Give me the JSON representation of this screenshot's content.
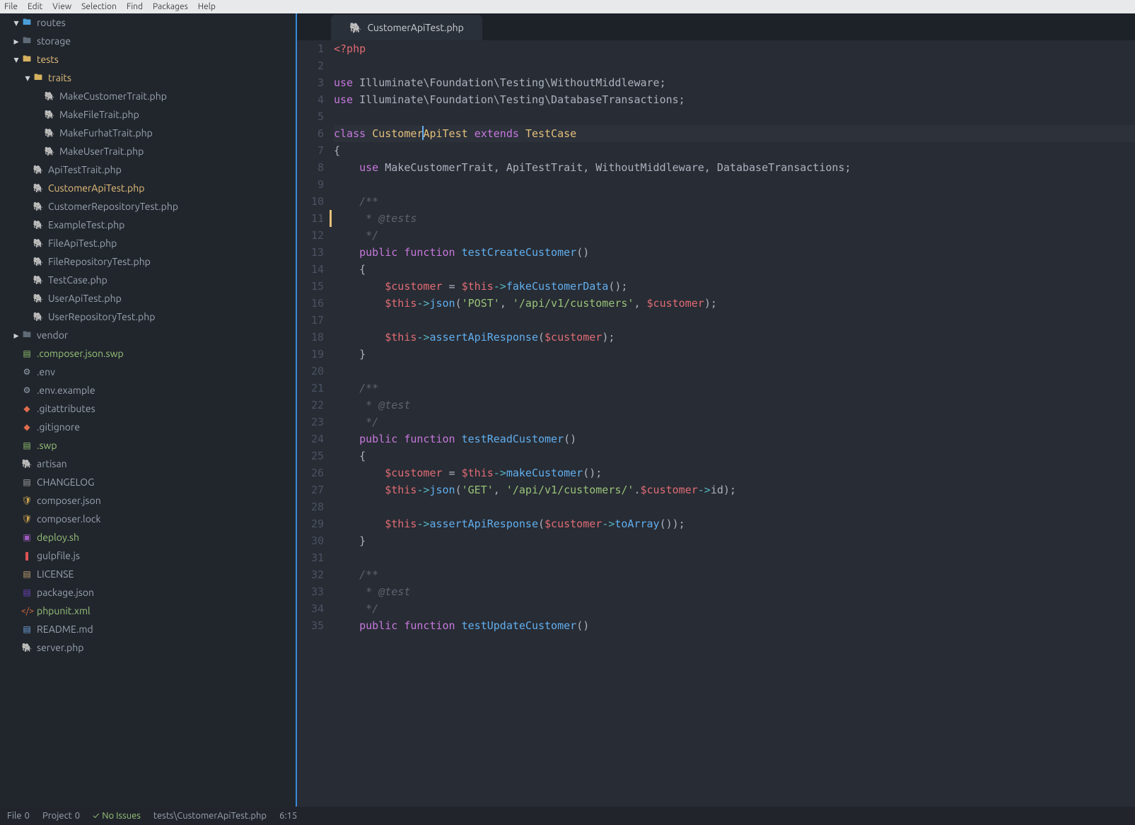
{
  "menu": [
    "File",
    "Edit",
    "View",
    "Selection",
    "Find",
    "Packages",
    "Help"
  ],
  "tree": [
    {
      "depth": 1,
      "caret": "▾",
      "icon": "folder open",
      "label": "routes",
      "tone": ""
    },
    {
      "depth": 1,
      "caret": "▸",
      "icon": "folder",
      "label": "storage",
      "tone": ""
    },
    {
      "depth": 1,
      "caret": "▾",
      "icon": "folder yellow",
      "label": "tests",
      "tone": "yellow"
    },
    {
      "depth": 2,
      "caret": "▾",
      "icon": "folder yellow",
      "label": "traits",
      "tone": "yellow"
    },
    {
      "depth": 3,
      "caret": " ",
      "icon": "php",
      "label": "MakeCustomerTrait.php",
      "tone": ""
    },
    {
      "depth": 3,
      "caret": " ",
      "icon": "php",
      "label": "MakeFileTrait.php",
      "tone": ""
    },
    {
      "depth": 3,
      "caret": " ",
      "icon": "php",
      "label": "MakeFurhatTrait.php",
      "tone": ""
    },
    {
      "depth": 3,
      "caret": " ",
      "icon": "php",
      "label": "MakeUserTrait.php",
      "tone": ""
    },
    {
      "depth": 2,
      "caret": " ",
      "icon": "php",
      "label": "ApiTestTrait.php",
      "tone": ""
    },
    {
      "depth": 2,
      "caret": " ",
      "icon": "php",
      "label": "CustomerApiTest.php",
      "tone": "selected"
    },
    {
      "depth": 2,
      "caret": " ",
      "icon": "php",
      "label": "CustomerRepositoryTest.php",
      "tone": ""
    },
    {
      "depth": 2,
      "caret": " ",
      "icon": "php",
      "label": "ExampleTest.php",
      "tone": ""
    },
    {
      "depth": 2,
      "caret": " ",
      "icon": "php",
      "label": "FileApiTest.php",
      "tone": ""
    },
    {
      "depth": 2,
      "caret": " ",
      "icon": "php",
      "label": "FileRepositoryTest.php",
      "tone": ""
    },
    {
      "depth": 2,
      "caret": " ",
      "icon": "php",
      "label": "TestCase.php",
      "tone": ""
    },
    {
      "depth": 2,
      "caret": " ",
      "icon": "php",
      "label": "UserApiTest.php",
      "tone": ""
    },
    {
      "depth": 2,
      "caret": " ",
      "icon": "php",
      "label": "UserRepositoryTest.php",
      "tone": ""
    },
    {
      "depth": 1,
      "caret": "▸",
      "icon": "folder",
      "label": "vendor",
      "tone": ""
    },
    {
      "depth": 1,
      "caret": " ",
      "icon": "db",
      "label": ".composer.json.swp",
      "tone": "green"
    },
    {
      "depth": 1,
      "caret": " ",
      "icon": "gear",
      "label": ".env",
      "tone": ""
    },
    {
      "depth": 1,
      "caret": " ",
      "icon": "gear",
      "label": ".env.example",
      "tone": ""
    },
    {
      "depth": 1,
      "caret": " ",
      "icon": "git",
      "label": ".gitattributes",
      "tone": ""
    },
    {
      "depth": 1,
      "caret": " ",
      "icon": "git",
      "label": ".gitignore",
      "tone": ""
    },
    {
      "depth": 1,
      "caret": " ",
      "icon": "db",
      "label": ".swp",
      "tone": "green"
    },
    {
      "depth": 1,
      "caret": " ",
      "icon": "php",
      "label": "artisan",
      "tone": ""
    },
    {
      "depth": 1,
      "caret": " ",
      "icon": "txt",
      "label": "CHANGELOG",
      "tone": ""
    },
    {
      "depth": 1,
      "caret": " ",
      "icon": "lock",
      "label": "composer.json",
      "tone": ""
    },
    {
      "depth": 1,
      "caret": " ",
      "icon": "lock",
      "label": "composer.lock",
      "tone": ""
    },
    {
      "depth": 1,
      "caret": " ",
      "icon": "sh",
      "label": "deploy.sh",
      "tone": "green"
    },
    {
      "depth": 1,
      "caret": " ",
      "icon": "js",
      "label": "gulpfile.js",
      "tone": ""
    },
    {
      "depth": 1,
      "caret": " ",
      "icon": "lic",
      "label": "LICENSE",
      "tone": ""
    },
    {
      "depth": 1,
      "caret": " ",
      "icon": "json",
      "label": "package.json",
      "tone": ""
    },
    {
      "depth": 1,
      "caret": " ",
      "icon": "xml",
      "label": "phpunit.xml",
      "tone": "green"
    },
    {
      "depth": 1,
      "caret": " ",
      "icon": "md",
      "label": "README.md",
      "tone": ""
    },
    {
      "depth": 1,
      "caret": " ",
      "icon": "php",
      "label": "server.php",
      "tone": ""
    }
  ],
  "tab": {
    "label": "CustomerApiTest.php"
  },
  "code": {
    "current_line": 6,
    "fold_markers": [
      11
    ],
    "lines": [
      [
        {
          "c": "php",
          "t": "<?php"
        }
      ],
      [],
      [
        {
          "c": "kw",
          "t": "use"
        },
        {
          "t": " "
        },
        {
          "c": "imp",
          "t": "Illuminate\\Foundation\\Testing\\WithoutMiddleware"
        },
        {
          "t": ";"
        }
      ],
      [
        {
          "c": "kw",
          "t": "use"
        },
        {
          "t": " "
        },
        {
          "c": "imp",
          "t": "Illuminate\\Foundation\\Testing\\DatabaseTransactions"
        },
        {
          "t": ";"
        }
      ],
      [],
      [
        {
          "c": "kw",
          "t": "class"
        },
        {
          "t": " "
        },
        {
          "c": "cls",
          "t": "Customer"
        },
        {
          "cursor": true
        },
        {
          "c": "cls",
          "t": "ApiTest"
        },
        {
          "t": " "
        },
        {
          "c": "kw",
          "t": "extends"
        },
        {
          "t": " "
        },
        {
          "c": "cls",
          "t": "TestCase"
        }
      ],
      [
        {
          "t": "{"
        }
      ],
      [
        {
          "t": "    "
        },
        {
          "c": "kw",
          "t": "use"
        },
        {
          "t": " MakeCustomerTrait, ApiTestTrait, WithoutMiddleware, DatabaseTransactions;"
        }
      ],
      [],
      [
        {
          "t": "    "
        },
        {
          "c": "com",
          "t": "/**"
        }
      ],
      [
        {
          "t": "    "
        },
        {
          "c": "com",
          "t": " * @tests"
        }
      ],
      [
        {
          "t": "    "
        },
        {
          "c": "com",
          "t": " */"
        }
      ],
      [
        {
          "t": "    "
        },
        {
          "c": "kw",
          "t": "public"
        },
        {
          "t": " "
        },
        {
          "c": "kw",
          "t": "function"
        },
        {
          "t": " "
        },
        {
          "c": "fn",
          "t": "testCreateCustomer"
        },
        {
          "t": "()"
        }
      ],
      [
        {
          "t": "    {"
        }
      ],
      [
        {
          "t": "        "
        },
        {
          "c": "var",
          "t": "$customer"
        },
        {
          "t": " = "
        },
        {
          "c": "var",
          "t": "$this"
        },
        {
          "c": "op",
          "t": "->"
        },
        {
          "c": "fn",
          "t": "fakeCustomerData"
        },
        {
          "t": "();"
        }
      ],
      [
        {
          "t": "        "
        },
        {
          "c": "var",
          "t": "$this"
        },
        {
          "c": "op",
          "t": "->"
        },
        {
          "c": "fn",
          "t": "json"
        },
        {
          "t": "("
        },
        {
          "c": "str",
          "t": "'POST'"
        },
        {
          "t": ", "
        },
        {
          "c": "str",
          "t": "'/api/v1/customers'"
        },
        {
          "t": ", "
        },
        {
          "c": "var",
          "t": "$customer"
        },
        {
          "t": ");"
        }
      ],
      [],
      [
        {
          "t": "        "
        },
        {
          "c": "var",
          "t": "$this"
        },
        {
          "c": "op",
          "t": "->"
        },
        {
          "c": "fn",
          "t": "assertApiResponse"
        },
        {
          "t": "("
        },
        {
          "c": "var",
          "t": "$customer"
        },
        {
          "t": ");"
        }
      ],
      [
        {
          "t": "    }"
        }
      ],
      [],
      [
        {
          "t": "    "
        },
        {
          "c": "com",
          "t": "/**"
        }
      ],
      [
        {
          "t": "    "
        },
        {
          "c": "com",
          "t": " * @test"
        }
      ],
      [
        {
          "t": "    "
        },
        {
          "c": "com",
          "t": " */"
        }
      ],
      [
        {
          "t": "    "
        },
        {
          "c": "kw",
          "t": "public"
        },
        {
          "t": " "
        },
        {
          "c": "kw",
          "t": "function"
        },
        {
          "t": " "
        },
        {
          "c": "fn",
          "t": "testReadCustomer"
        },
        {
          "t": "()"
        }
      ],
      [
        {
          "t": "    {"
        }
      ],
      [
        {
          "t": "        "
        },
        {
          "c": "var",
          "t": "$customer"
        },
        {
          "t": " = "
        },
        {
          "c": "var",
          "t": "$this"
        },
        {
          "c": "op",
          "t": "->"
        },
        {
          "c": "fn",
          "t": "makeCustomer"
        },
        {
          "t": "();"
        }
      ],
      [
        {
          "t": "        "
        },
        {
          "c": "var",
          "t": "$this"
        },
        {
          "c": "op",
          "t": "->"
        },
        {
          "c": "fn",
          "t": "json"
        },
        {
          "t": "("
        },
        {
          "c": "str",
          "t": "'GET'"
        },
        {
          "t": ", "
        },
        {
          "c": "str",
          "t": "'/api/v1/customers/'"
        },
        {
          "t": "."
        },
        {
          "c": "var",
          "t": "$customer"
        },
        {
          "c": "op",
          "t": "->"
        },
        {
          "c": "imp",
          "t": "id"
        },
        {
          "t": ");"
        }
      ],
      [],
      [
        {
          "t": "        "
        },
        {
          "c": "var",
          "t": "$this"
        },
        {
          "c": "op",
          "t": "->"
        },
        {
          "c": "fn",
          "t": "assertApiResponse"
        },
        {
          "t": "("
        },
        {
          "c": "var",
          "t": "$customer"
        },
        {
          "c": "op",
          "t": "->"
        },
        {
          "c": "fn",
          "t": "toArray"
        },
        {
          "t": "());"
        }
      ],
      [
        {
          "t": "    }"
        }
      ],
      [],
      [
        {
          "t": "    "
        },
        {
          "c": "com",
          "t": "/**"
        }
      ],
      [
        {
          "t": "    "
        },
        {
          "c": "com",
          "t": " * @test"
        }
      ],
      [
        {
          "t": "    "
        },
        {
          "c": "com",
          "t": " */"
        }
      ],
      [
        {
          "t": "    "
        },
        {
          "c": "kw",
          "t": "public"
        },
        {
          "t": " "
        },
        {
          "c": "kw",
          "t": "function"
        },
        {
          "t": " "
        },
        {
          "c": "fn",
          "t": "testUpdateCustomer"
        },
        {
          "t": "()"
        }
      ]
    ]
  },
  "status": {
    "file_count_label": "File",
    "file_count_value": "0",
    "project_count_label": "Project",
    "project_count_value": "0",
    "issues_icon": "✓",
    "issues_text": "No Issues",
    "path": "tests\\CustomerApiTest.php",
    "cursor": "6:15"
  },
  "icons": {
    "folder": "🖿",
    "php": "🐘",
    "gear": "⚙",
    "git": "◆",
    "json": "▤",
    "md": "▤",
    "js": "❚",
    "xml": "</>",
    "sh": "▣",
    "lock": "🛡",
    "txt": "▤",
    "lic": "▤",
    "db": "▤"
  }
}
